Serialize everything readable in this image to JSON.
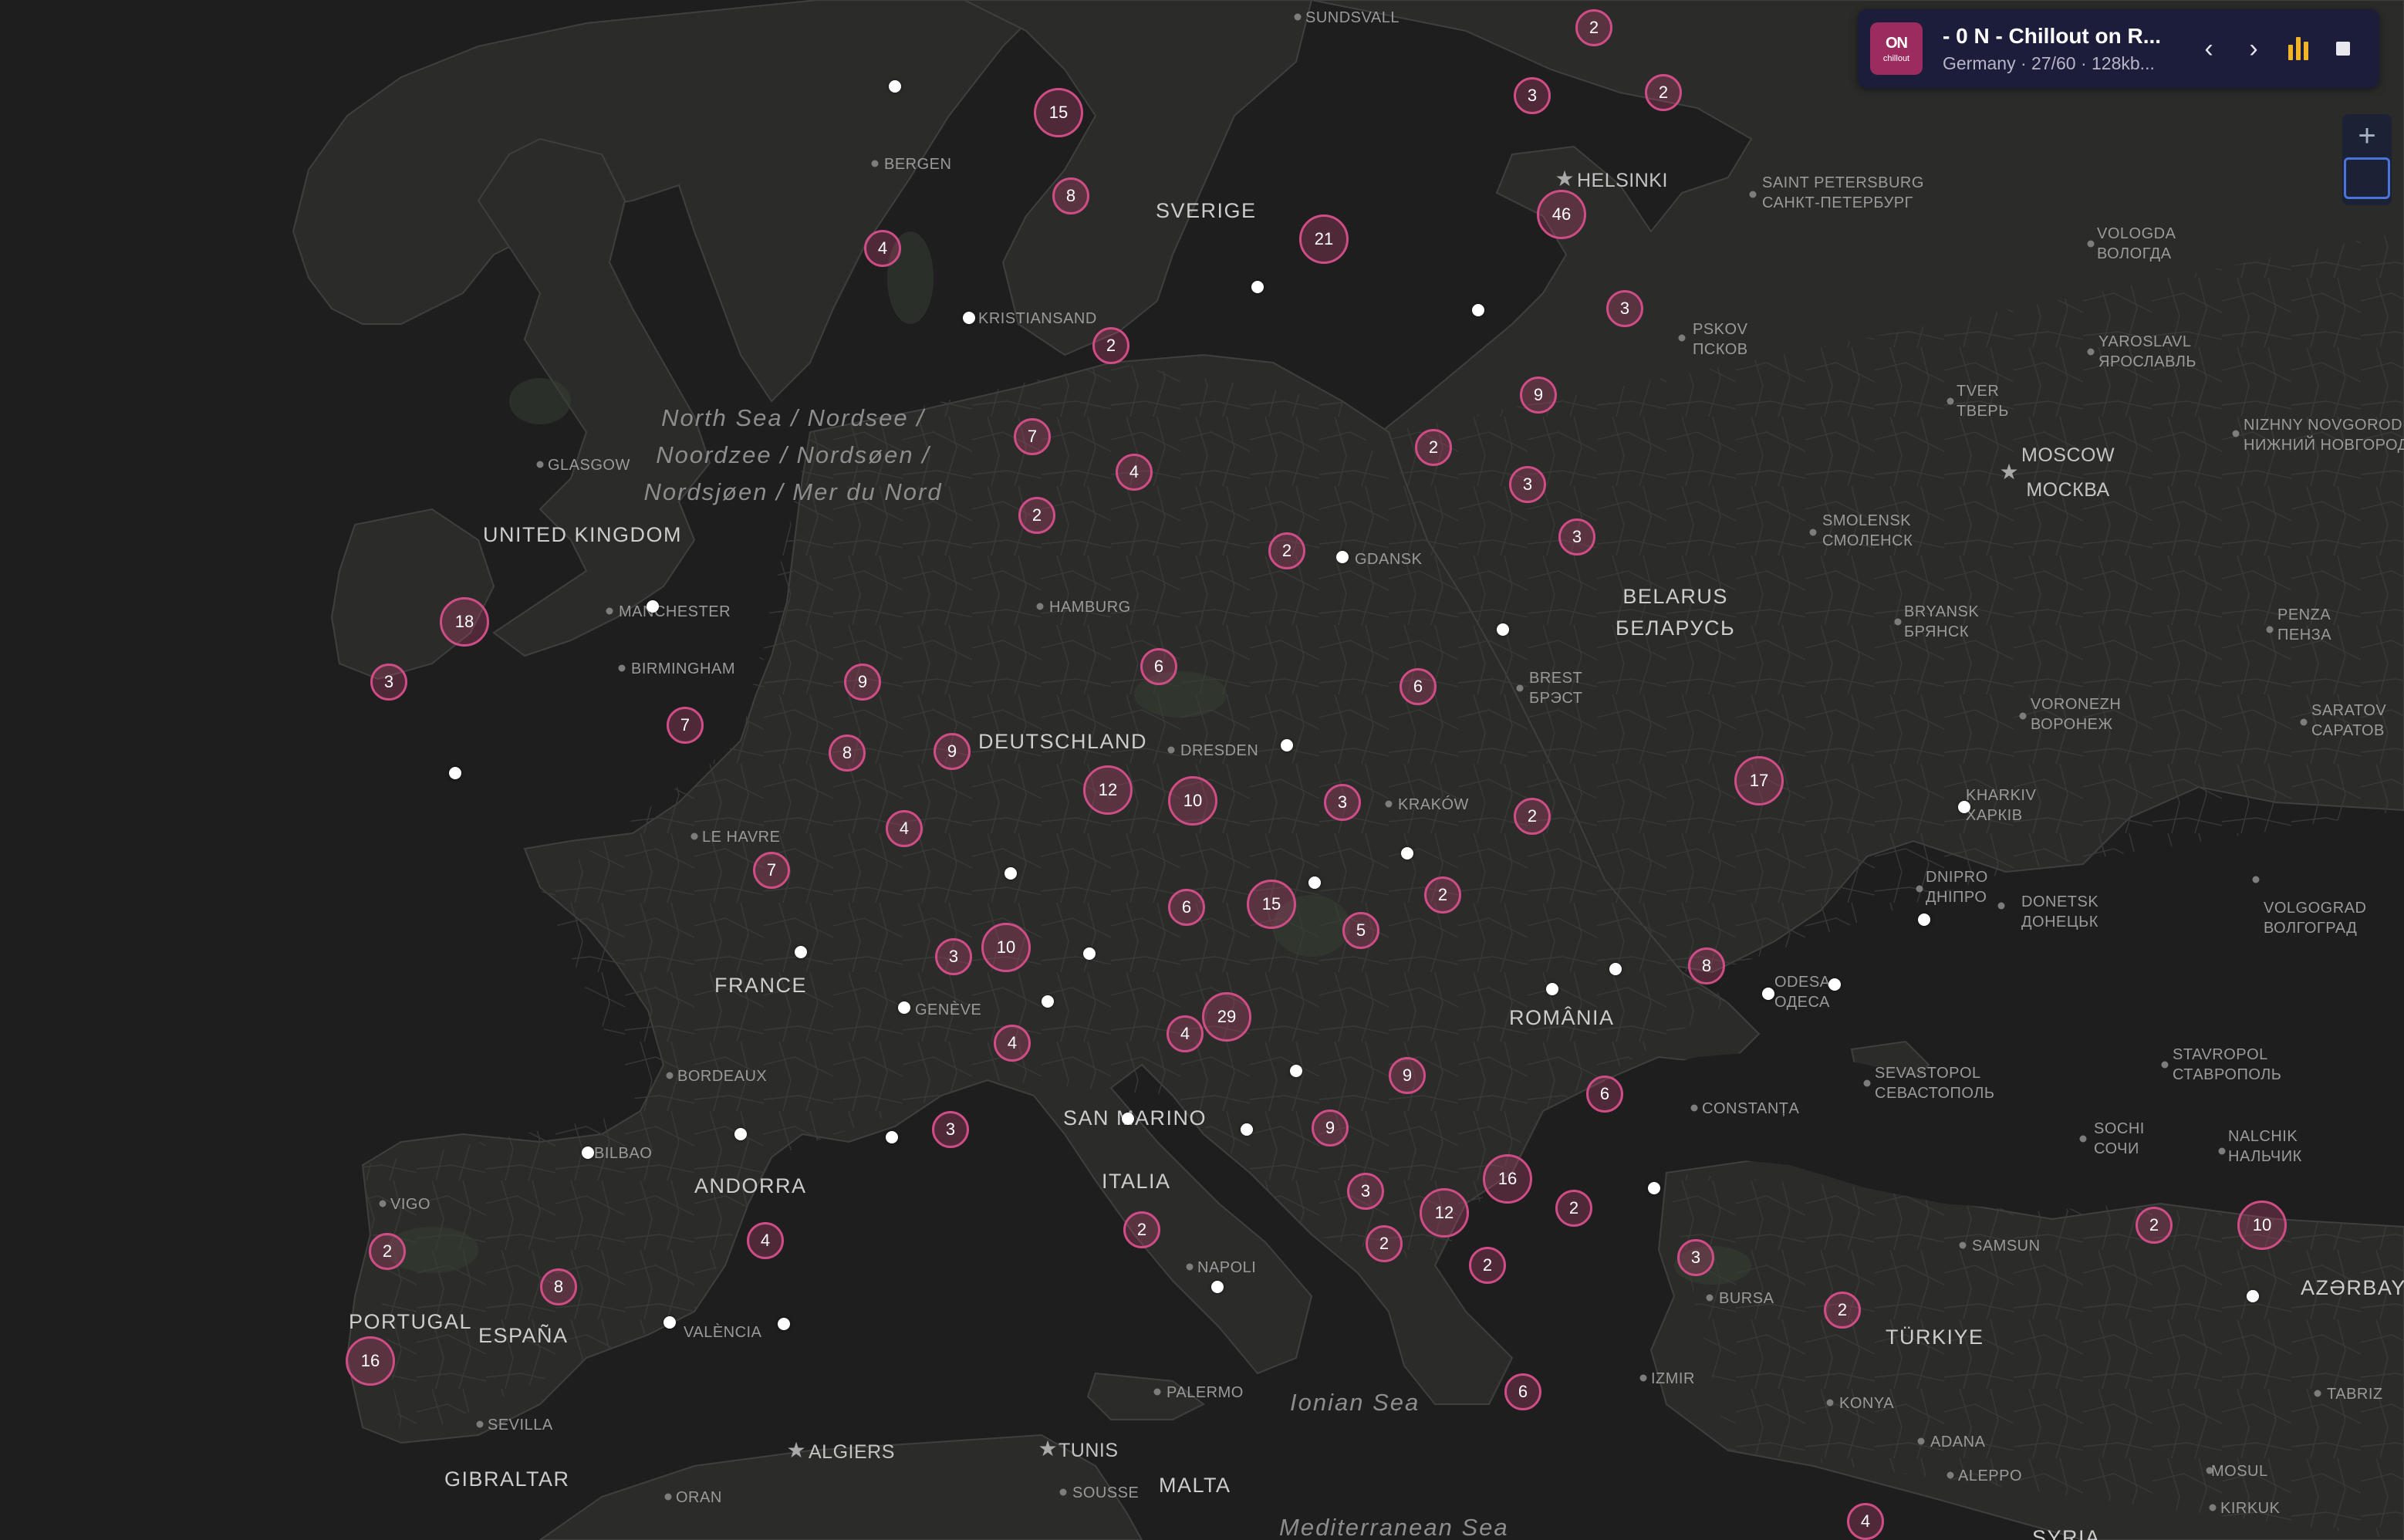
{
  "player": {
    "logo_text": "ON",
    "logo_sub": "chillout",
    "station_title": "- 0 N - Chillout on R...",
    "station_meta": "Germany · 27/60 · 128kb...",
    "prev_icon": "chevron-left-icon",
    "next_icon": "chevron-right-icon",
    "equalizer_icon": "equalizer-icon",
    "stop_icon": "stop-icon",
    "accent_color": "#f0b429",
    "background_color": "#1b1d3b"
  },
  "zoom": {
    "in_label": "+",
    "out_label": "−"
  },
  "colors": {
    "cluster_border": "#cf4d86",
    "station_dot": "#ffffff",
    "water": "#1e1e1f",
    "land": "#2b2c2a"
  },
  "labels": {
    "sundsvall": "SUNDSVALL",
    "bergen": "BERGEN",
    "sverige": "SVERIGE",
    "helsinki": "HELSINKI",
    "saint_petersburg_en": "SAINT PETERSBURG",
    "saint_petersburg_ru": "САНКТ-ПЕТЕРБУРГ",
    "vologda_en": "VOLOGDA",
    "vologda_ru": "ВОЛОГДА",
    "kristiansand": "KRISTIANSAND",
    "pskov_en": "PSKOV",
    "pskov_ru": "ПСКОВ",
    "yaroslavl_en": "YAROSLAVL",
    "yaroslavl_ru": "ЯРОСЛАВЛЬ",
    "tver_en": "TVER",
    "tver_ru": "ТВЕРЬ",
    "nizhny_en": "NIZHNY NOVGOROD",
    "nizhny_ru": "НИЖНИЙ НОВГОРОД",
    "north_sea_1": "North Sea / Nordsee /",
    "north_sea_2": "Noordzee / Nordsøen /",
    "north_sea_3": "Nordsjøen / Mer du Nord",
    "glasgow": "GLASGOW",
    "moscow_en": "MOSCOW",
    "moscow_ru": "МОСКВА",
    "united_kingdom": "UNITED KINGDOM",
    "smolensk_en": "SMOLENSK",
    "smolensk_ru": "СМОЛЕНСК",
    "gdansk": "GDANSK",
    "hamburg": "HAMBURG",
    "manchester": "MANCHESTER",
    "belarus_en": "BELARUS",
    "belarus_ru": "БЕЛАРУСЬ",
    "bryansk_en": "BRYANSK",
    "bryansk_ru": "БРЯНСК",
    "penza_en": "PENZA",
    "penza_ru": "ПЕНЗА",
    "birmingham": "BIRMINGHAM",
    "brest_en": "BREST",
    "brest_ru": "БРЭСТ",
    "voronezh_en": "VORONEZH",
    "voronezh_ru": "ВОРОНЕЖ",
    "saratov_en": "SARATOV",
    "saratov_ru": "САРАТОВ",
    "deutschland": "DEUTSCHLAND",
    "dresden": "DRESDEN",
    "krakow": "KRAKÓW",
    "kharkiv_en": "KHARKIV",
    "kharkiv_ru": "ХАРКІВ",
    "le_havre": "LE HAVRE",
    "dnipro_en": "DNIPRO",
    "dnipro_ru": "ДНІПРО",
    "donetsk_en": "DONETSK",
    "donetsk_ru": "ДОНЕЦЬК",
    "volgograd_en": "VOLGOGRAD",
    "volgograd_ru": "ВОЛГОГРАД",
    "france": "FRANCE",
    "odesa_en": "ODESA",
    "odesa_ru": "ОДЕСА",
    "geneve": "GENÈVE",
    "romania": "ROMÂNIA",
    "bordeaux": "BORDEAUX",
    "sevastopol_en": "SEVASTOPOL",
    "sevastopol_ru": "СЕВАСТОПОЛЬ",
    "stavropol_en": "STAVROPOL",
    "stavropol_ru": "СТАВРОПОЛЬ",
    "san_marino": "SAN MARINO",
    "constanta": "CONSTANȚA",
    "sochi_en": "SOCHI",
    "sochi_ru": "СОЧИ",
    "nalchik_en": "NALCHIK",
    "nalchik_ru": "НАЛЬЧИК",
    "bilbao": "BILBAO",
    "vigo": "VIGO",
    "andorra": "ANDORRA",
    "italia": "ITALIA",
    "samsun": "SAMSUN",
    "azerbaycan": "AZƏRBAYC",
    "napoli": "NAPOLI",
    "bursa": "BURSA",
    "portugal": "PORTUGAL",
    "espana": "ESPAÑA",
    "valencia": "VALÈNCIA",
    "turkiye": "TÜRKIYE",
    "izmir": "IZMIR",
    "palermo": "PALERMO",
    "ionian_sea": "Ionian Sea",
    "konya": "KONYA",
    "tabriz": "TABRIZ",
    "sevilla": "SEVILLA",
    "adana": "ADANA",
    "mosul": "MOSUL",
    "gibraltar": "GIBRALTAR",
    "algiers": "ALGIERS",
    "tunis": "TUNIS",
    "aleppo": "ALEPPO",
    "malta": "MALTA",
    "sousse": "SOUSSE",
    "oran": "ORAN",
    "kirkuk": "KIRKUK",
    "mediterranean_sea": "Mediterranean Sea",
    "syria": "SYRIA"
  },
  "clusters": [
    {
      "name": "finland-north",
      "count": "2"
    },
    {
      "name": "finland-west",
      "count": "3"
    },
    {
      "name": "finland-east",
      "count": "2"
    },
    {
      "name": "norway-central",
      "count": "15"
    },
    {
      "name": "norway-south",
      "count": "8"
    },
    {
      "name": "stockholm",
      "count": "21"
    },
    {
      "name": "helsinki",
      "count": "46"
    },
    {
      "name": "bergen-south",
      "count": "4"
    },
    {
      "name": "gothenburg",
      "count": "2"
    },
    {
      "name": "estonia",
      "count": "3"
    },
    {
      "name": "latvia",
      "count": "9"
    },
    {
      "name": "denmark-north",
      "count": "7"
    },
    {
      "name": "malmo",
      "count": "4"
    },
    {
      "name": "denmark-south",
      "count": "2"
    },
    {
      "name": "lithuania-west",
      "count": "2"
    },
    {
      "name": "lithuania-east",
      "count": "3"
    },
    {
      "name": "vilnius",
      "count": "3"
    },
    {
      "name": "poland-north",
      "count": "2"
    },
    {
      "name": "ireland-east",
      "count": "18"
    },
    {
      "name": "ireland-west",
      "count": "3"
    },
    {
      "name": "amsterdam",
      "count": "9"
    },
    {
      "name": "berlin",
      "count": "6"
    },
    {
      "name": "warsaw",
      "count": "6"
    },
    {
      "name": "london",
      "count": "7"
    },
    {
      "name": "brussels",
      "count": "8"
    },
    {
      "name": "cologne",
      "count": "9"
    },
    {
      "name": "frankfurt",
      "count": "12"
    },
    {
      "name": "prague",
      "count": "10"
    },
    {
      "name": "krakow",
      "count": "3"
    },
    {
      "name": "lviv",
      "count": "2"
    },
    {
      "name": "kyiv",
      "count": "17"
    },
    {
      "name": "luxembourg",
      "count": "4"
    },
    {
      "name": "paris",
      "count": "7"
    },
    {
      "name": "munich",
      "count": "6"
    },
    {
      "name": "vienna",
      "count": "15"
    },
    {
      "name": "slovakia",
      "count": "5"
    },
    {
      "name": "moldova-north",
      "count": "2"
    },
    {
      "name": "zurich",
      "count": "3"
    },
    {
      "name": "bern",
      "count": "10"
    },
    {
      "name": "ljubljana",
      "count": "29"
    },
    {
      "name": "odesa-west",
      "count": "8"
    },
    {
      "name": "turin",
      "count": "4"
    },
    {
      "name": "rijeka",
      "count": "4"
    },
    {
      "name": "belgrade-north",
      "count": "9"
    },
    {
      "name": "bucharest",
      "count": "6"
    },
    {
      "name": "marseille",
      "count": "3"
    },
    {
      "name": "sarajevo",
      "count": "9"
    },
    {
      "name": "sofia",
      "count": "16"
    },
    {
      "name": "montenegro",
      "count": "3"
    },
    {
      "name": "skopje",
      "count": "12"
    },
    {
      "name": "bulgaria-east",
      "count": "2"
    },
    {
      "name": "istanbul",
      "count": "3"
    },
    {
      "name": "georgia-west",
      "count": "2"
    },
    {
      "name": "tbilisi",
      "count": "10"
    },
    {
      "name": "barcelona",
      "count": "4"
    },
    {
      "name": "rome",
      "count": "2"
    },
    {
      "name": "albania",
      "count": "2"
    },
    {
      "name": "thessaloniki",
      "count": "2"
    },
    {
      "name": "galicia",
      "count": "2"
    },
    {
      "name": "madrid",
      "count": "8"
    },
    {
      "name": "ankara",
      "count": "2"
    },
    {
      "name": "lisbon",
      "count": "16"
    },
    {
      "name": "athens",
      "count": "6"
    },
    {
      "name": "cyprus",
      "count": "4"
    }
  ]
}
